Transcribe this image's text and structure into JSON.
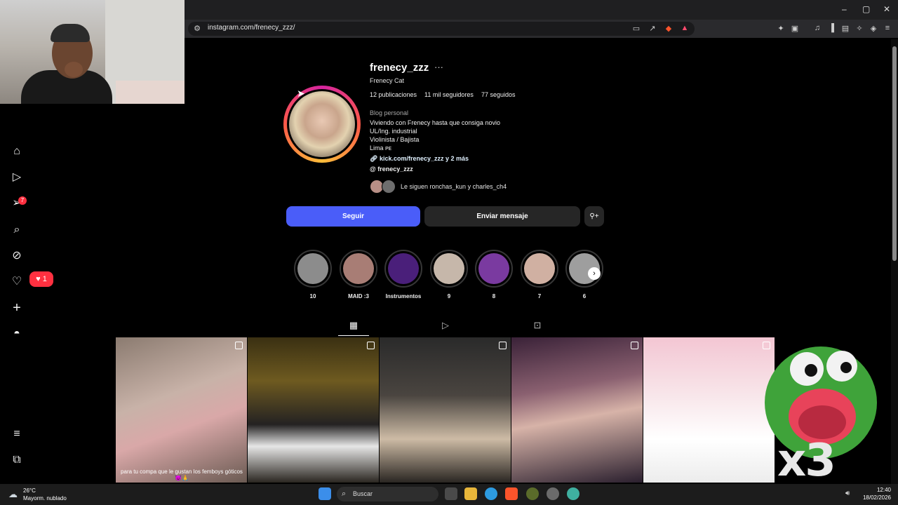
{
  "browser": {
    "url": "instagram.com/frenecy_zzz/",
    "window_controls": [
      "–",
      "▢",
      "✕"
    ]
  },
  "nav": {
    "notification_count": "7",
    "likes_count": "1"
  },
  "profile": {
    "username": "frenecy_zzz",
    "more": "···",
    "full_name": "Frenecy Cat",
    "stats": {
      "posts": "12 publicaciones",
      "followers": "11 mil seguidores",
      "following": "77 seguidos"
    },
    "category": "Blog personal",
    "bio": [
      "Viviendo con Frenecy hasta que consiga novio",
      "UL/Ing. industrial",
      "Violinista / Bajista",
      "Lima ᴘᴇ"
    ],
    "link": "kick.com/frenecy_zzz y 2 más",
    "threads": "frenecy_zzz",
    "followed_by": "Le siguen ronchas_kun y charles_ch4"
  },
  "actions": {
    "follow": "Seguir",
    "message": "Enviar mensaje"
  },
  "highlights": [
    "10",
    "MAID :3",
    "Instrumentos",
    "9",
    "8",
    "7",
    "6"
  ],
  "posts": {
    "caption_1": "para tu compa que le gustan los femboys góticos 😈🙏"
  },
  "overlay": {
    "x3": "x3"
  },
  "taskbar": {
    "temp": "26°C",
    "weather": "Mayorm. nublado",
    "search": "Buscar",
    "time": "12:40",
    "date": "18/02/2026"
  }
}
